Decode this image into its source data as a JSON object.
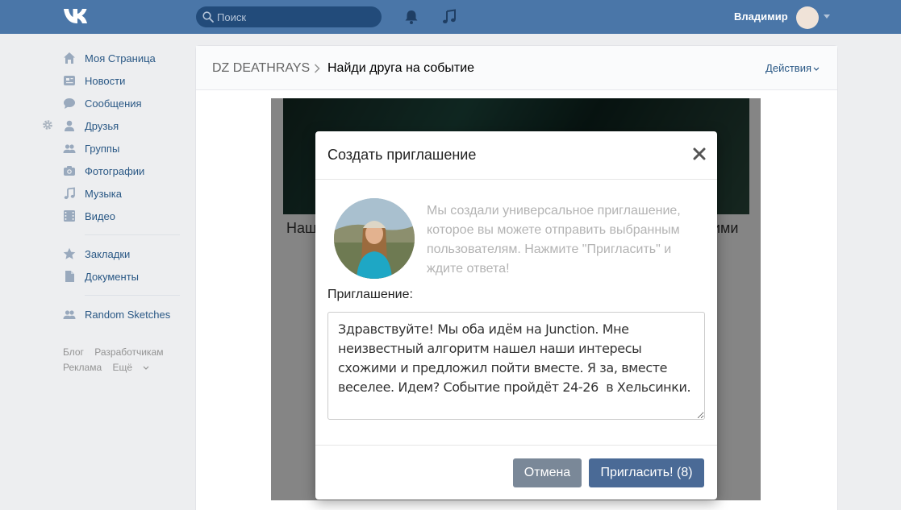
{
  "header": {
    "logo_icon": "vk-logo-icon",
    "search_placeholder": "Поиск",
    "user_name": "Владимир"
  },
  "sidebar": {
    "items": [
      {
        "label": "Моя Страница",
        "icon": "home-icon"
      },
      {
        "label": "Новости",
        "icon": "news-icon"
      },
      {
        "label": "Сообщения",
        "icon": "messages-icon"
      },
      {
        "label": "Друзья",
        "icon": "friends-icon"
      },
      {
        "label": "Группы",
        "icon": "groups-icon"
      },
      {
        "label": "Фотографии",
        "icon": "camera-icon"
      },
      {
        "label": "Музыка",
        "icon": "music-icon"
      },
      {
        "label": "Видео",
        "icon": "video-icon"
      },
      {
        "label": "Закладки",
        "icon": "star-icon"
      },
      {
        "label": "Документы",
        "icon": "document-icon"
      },
      {
        "label": "Random Sketches",
        "icon": "app-icon"
      }
    ],
    "footer": {
      "blog": "Блог",
      "developers": "Разработчикам",
      "ads": "Реклама",
      "more": "Ещё"
    }
  },
  "panel": {
    "breadcrumb_group": "DZ DEATHRAYS",
    "breadcrumb_page": "Найди друга на событие",
    "actions_label": "Действия",
    "event_text_left": "Наш",
    "event_text_right": "ими"
  },
  "modal": {
    "title": "Создать приглашение",
    "description": "Мы создали универсальное приглашение, которое вы можете отправить выбранным пользователям. Нажмите \"Пригласить\" и ждите ответа!",
    "invitation_label": "Приглашение:",
    "invitation_text": "Здравствуйте! Мы оба идём на Junction. Мне неизвестный алгоритм нашел наши интересы схожими и предложил пойти вместе. Я за, вместе веселее. Идем? Событие пройдёт 24-26  в Хельсинки.",
    "cancel_label": "Отмена",
    "invite_label": "Пригласить! (8)"
  },
  "colors": {
    "header_bg": "#4a76a8",
    "link": "#2a5885",
    "invite_button": "#4a6a96",
    "cancel_button": "#7a8898"
  }
}
